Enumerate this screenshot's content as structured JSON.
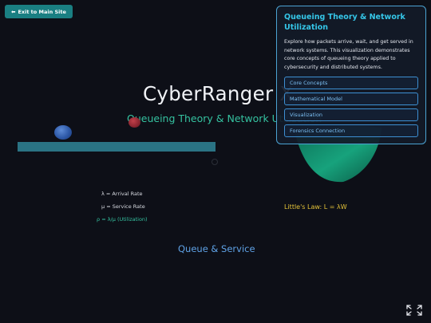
{
  "exit_button": {
    "arrow": "⬅",
    "label": "Exit to Main Site"
  },
  "hero": {
    "title": "CyberRanger X",
    "subtitle": "Queueing Theory & Network Utilization"
  },
  "legend": {
    "arrival": "λ = Arrival Rate",
    "service": "μ = Service Rate",
    "utilization": "ρ = λ/μ (Utilization)"
  },
  "formula": {
    "littles_law": "Little's Law: L = λW"
  },
  "scene_label": "Queue & Service",
  "info_panel": {
    "title": "Queueing Theory & Network Utilization",
    "description": "Explore how packets arrive, wait, and get served in network systems. This visualization demonstrates core concepts of queueing theory applied to cybersecurity and distributed systems.",
    "links": [
      {
        "label": "Core Concepts"
      },
      {
        "label": "Mathematical Model"
      },
      {
        "label": "Visualization"
      },
      {
        "label": "Forensics Connection"
      }
    ]
  },
  "colors": {
    "background": "#0d0f17",
    "accent_teal": "#35c2a0",
    "panel_border": "#4ba3d3",
    "formula_yellow": "#e3c238",
    "queue_label_blue": "#5fa2e6"
  },
  "icons": {
    "exit": "arrow-left-icon",
    "fullscreen": "fullscreen-icon"
  }
}
